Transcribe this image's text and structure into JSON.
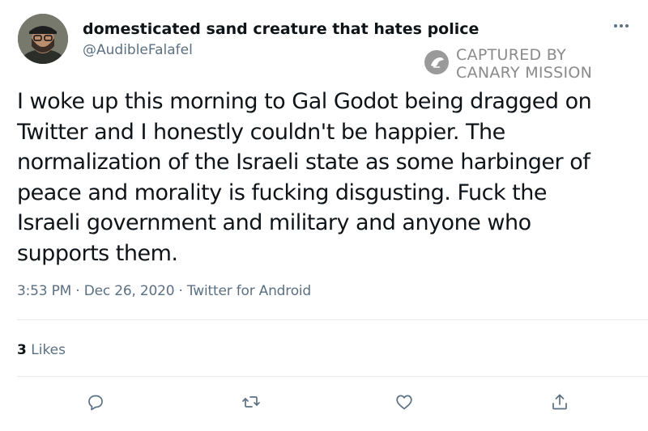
{
  "author": {
    "display_name": "domesticated sand creature that hates police",
    "handle": "@AudibleFalafel",
    "avatar_icon": "profile-photo"
  },
  "watermark": {
    "line1": "CAPTURED BY",
    "line2": "CANARY MISSION",
    "icon": "canary-mission-logo"
  },
  "tweet": {
    "lines": [
      "I woke up this morning to Gal Godot being dragged on",
      "Twitter and I honestly couldn't be happier. The",
      "normalization of the Israeli state as some harbinger of",
      "peace and morality is fucking disgusting. Fuck the",
      "Israeli government and military and anyone who",
      "supports them."
    ],
    "meta": "3:53 PM · Dec 26, 2020 · Twitter for Android"
  },
  "stats": {
    "likes_count": "3",
    "likes_label": "Likes"
  },
  "actions": {
    "reply_icon": "reply-icon",
    "retweet_icon": "retweet-icon",
    "like_icon": "like-icon",
    "share_icon": "share-icon",
    "more_icon": "more-icon"
  },
  "colors": {
    "text": "#0f1419",
    "secondary": "#5b7083",
    "divider": "#e6ecf0",
    "icon": "#5b7083",
    "watermark": "#8a8a8a"
  }
}
